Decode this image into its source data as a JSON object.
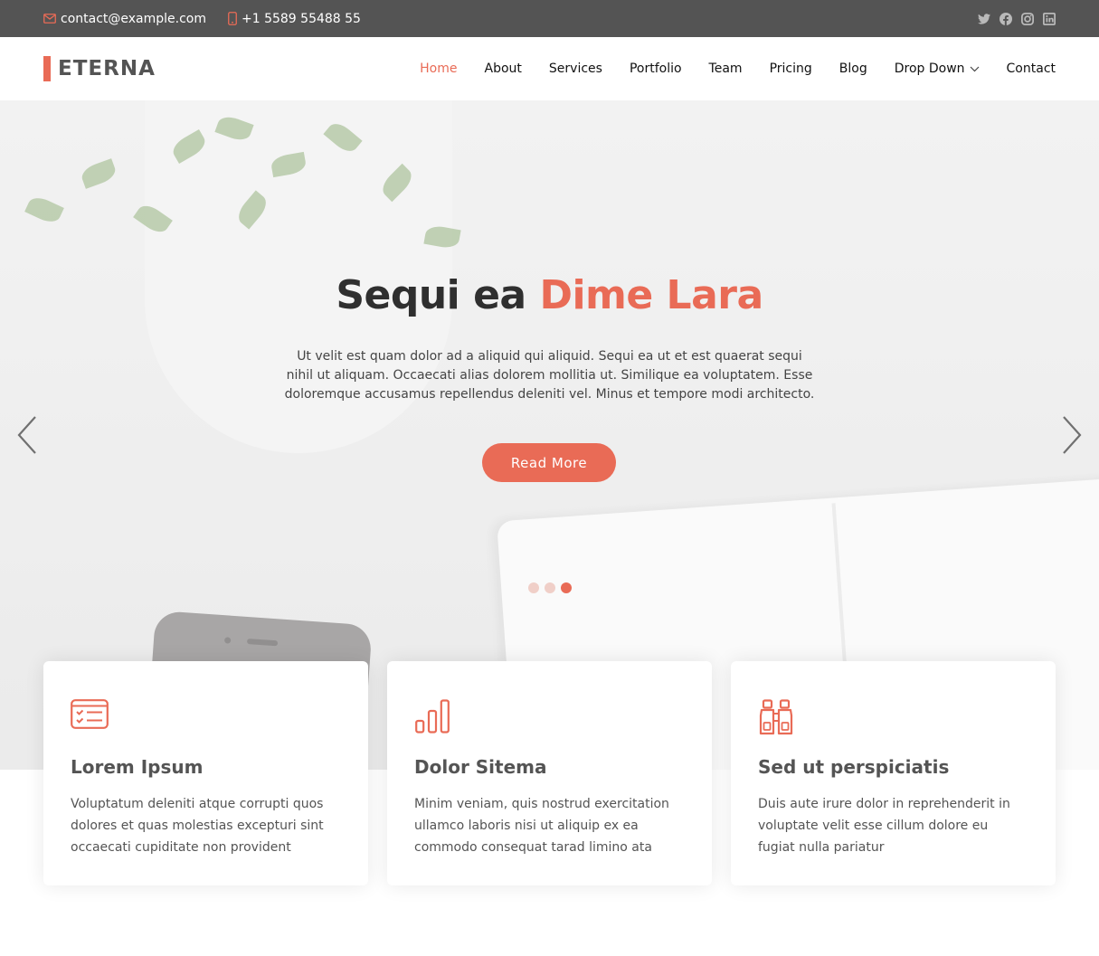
{
  "topbar": {
    "email": "contact@example.com",
    "phone": "+1 5589 55488 55",
    "social": [
      "twitter-icon",
      "facebook-icon",
      "instagram-icon",
      "linkedin-icon"
    ]
  },
  "header": {
    "logo": "ETERNA",
    "nav": [
      {
        "label": "Home",
        "active": true
      },
      {
        "label": "About"
      },
      {
        "label": "Services"
      },
      {
        "label": "Portfolio"
      },
      {
        "label": "Team"
      },
      {
        "label": "Pricing"
      },
      {
        "label": "Blog"
      },
      {
        "label": "Drop Down",
        "icon": "chevron-down-icon"
      },
      {
        "label": "Contact"
      }
    ]
  },
  "hero": {
    "title_part1": "Sequi ea ",
    "title_accent": "Dime Lara",
    "text": "Ut velit est quam dolor ad a aliquid qui aliquid. Sequi ea ut et est quaerat sequi nihil ut aliquam. Occaecati alias dolorem mollitia ut. Similique ea voluptatem. Esse doloremque accusamus repellendus deleniti vel. Minus et tempore modi architecto.",
    "button": "Read More",
    "slide_count": 3,
    "active_slide": 3
  },
  "features": [
    {
      "icon": "checklist-icon",
      "title": "Lorem Ipsum",
      "text": "Voluptatum deleniti atque corrupti quos dolores et quas molestias excepturi sint occaecati cupiditate non provident"
    },
    {
      "icon": "bar-chart-icon",
      "title": "Dolor Sitema",
      "text": "Minim veniam, quis nostrud exercitation ullamco laboris nisi ut aliquip ex ea commodo consequat tarad limino ata"
    },
    {
      "icon": "binoculars-icon",
      "title": "Sed ut perspiciatis",
      "text": "Duis aute irure dolor in reprehenderit in voluptate velit esse cillum dolore eu fugiat nulla pariatur"
    }
  ],
  "colors": {
    "accent": "#e96b56",
    "topbar_bg": "#545454",
    "heading": "#545454"
  }
}
